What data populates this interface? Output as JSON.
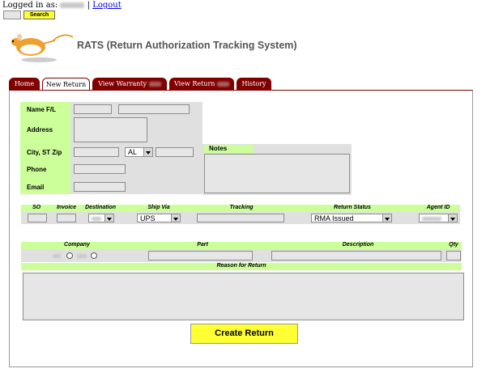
{
  "header": {
    "logged_in_label": "Logged in as:",
    "separator": "|",
    "logout_link": "Logout",
    "search_button": "Search",
    "app_title": "RATS (Return Authorization Tracking System)"
  },
  "tabs": [
    {
      "label": "Home"
    },
    {
      "label": "New Return"
    },
    {
      "label": "View Warranty"
    },
    {
      "label": "View Return"
    },
    {
      "label": "History"
    }
  ],
  "customer": {
    "name_label": "Name F/L",
    "address_label": "Address",
    "city_label": "City, ST Zip",
    "state_value": "AL",
    "phone_label": "Phone",
    "email_label": "Email",
    "notes_label": "Notes"
  },
  "order": {
    "headers": [
      "SO",
      "Invoice",
      "Destination",
      "Ship Via",
      "Tracking",
      "Return Status",
      "Agent ID"
    ],
    "ship_via_value": "UPS",
    "return_status_value": "RMA Issued"
  },
  "part": {
    "headers": [
      "Company",
      "Part",
      "Description",
      "Qty"
    ],
    "reason_header": "Reason for Return"
  },
  "create_button": "Create Return",
  "colors": {
    "tab_bg": "#800000",
    "green_label": "#ccff99",
    "form_bg": "#e6e6e6",
    "create_button_bg": "#ffff33"
  }
}
